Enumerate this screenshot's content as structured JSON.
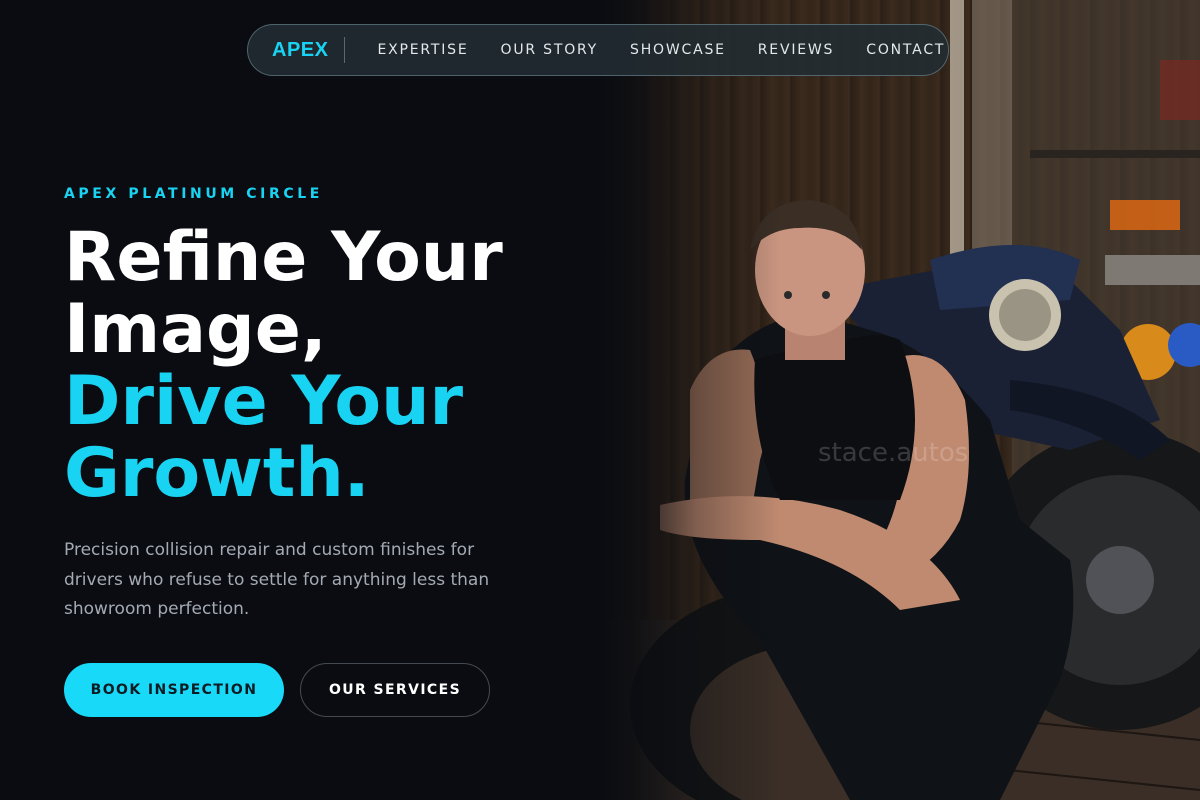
{
  "nav": {
    "logo": "APEX",
    "items": [
      {
        "label": "EXPERTISE"
      },
      {
        "label": "OUR STORY"
      },
      {
        "label": "SHOWCASE"
      },
      {
        "label": "REVIEWS"
      },
      {
        "label": "CONTACT"
      }
    ]
  },
  "hero": {
    "eyebrow": "APEX PLATINUM CIRCLE",
    "headline_line1": "Refine Your",
    "headline_line2": "Image,",
    "headline_line3": "Drive Your",
    "headline_line4": "Growth.",
    "description": "Precision collision repair and custom finishes for drivers who refuse to settle for anything less than showroom perfection.",
    "primary_cta": "BOOK INSPECTION",
    "secondary_cta": "OUR SERVICES"
  },
  "photo": {
    "watermark": "stace.autos"
  },
  "colors": {
    "accent": "#19d3f2",
    "background": "#0a0c11",
    "text_primary": "#ffffff",
    "text_muted": "#a4aab3"
  }
}
